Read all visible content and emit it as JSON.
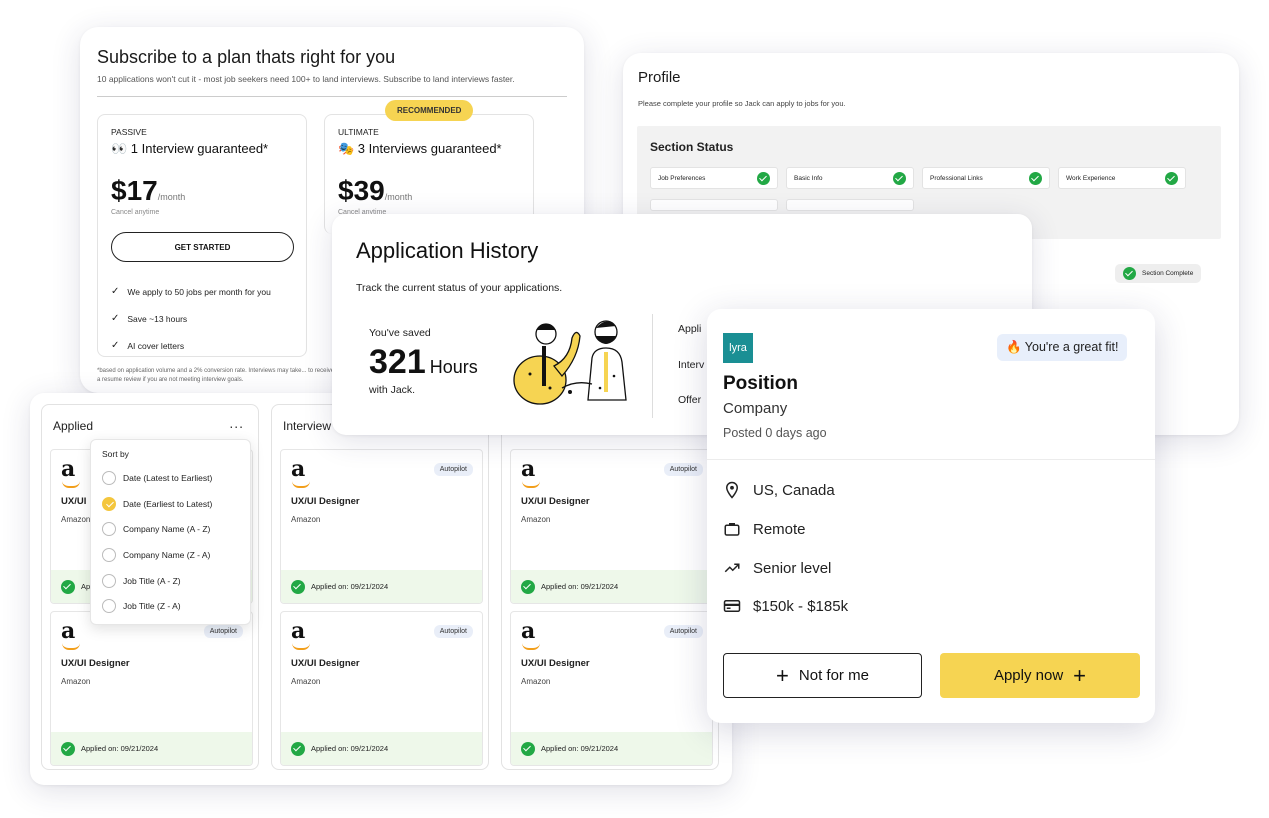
{
  "subscribe": {
    "title": "Subscribe to a plan thats right for you",
    "subtitle": "10 applications won't cut it - most job seekers need 100+ to land interviews. Subscribe to land interviews faster.",
    "recommended": "RECOMMENDED",
    "plans": [
      {
        "tier": "PASSIVE",
        "guarantee": "👀 1 Interview guaranteed*",
        "price": "$17",
        "period": "/month",
        "cancel": "Cancel anytime"
      },
      {
        "tier": "ULTIMATE",
        "guarantee": "🎭 3 Interviews guaranteed*",
        "price": "$39",
        "period": "/month",
        "cancel": "Cancel anytime"
      }
    ],
    "cta": "GET STARTED",
    "features": [
      "We apply to 50 jobs per month for you",
      "Save ~13 hours",
      "AI cover letters"
    ],
    "footnote": "*based on application volume and a 2% conversion rate. Interviews may take... to receive a resume review if you are not meeting interview goals."
  },
  "profile": {
    "title": "Profile",
    "subtitle": "Please complete your profile so Jack can apply to jobs for you.",
    "section_status": "Section Status",
    "chips": [
      "Job Preferences",
      "Basic Info",
      "Professional Links",
      "Work Experience"
    ],
    "section_complete": "Section Complete"
  },
  "kanban": {
    "columns": [
      {
        "title": "Applied",
        "menu": "..."
      },
      {
        "title": "Interview",
        "menu": ""
      },
      {
        "title": "",
        "menu": ""
      }
    ],
    "job": {
      "logo": "a",
      "badge": "Autopilot",
      "role": "UX/UI Designer",
      "company": "Amazon",
      "applied": "Applied on: 09/21/2024"
    },
    "applied_truncated": "Ap",
    "role_truncated": "UX/UI",
    "sort": {
      "header": "Sort by",
      "options": [
        "Date (Latest to Earliest)",
        "Date (Earliest to Latest)",
        "Company Name (A - Z)",
        "Company Name (Z - A)",
        "Job Title (A - Z)",
        "Job Title (Z - A)"
      ],
      "selected_index": 1
    }
  },
  "history": {
    "title": "Application History",
    "subtitle": "Track the current status of your applications.",
    "saved_label": "You've saved",
    "saved_value": "321",
    "saved_unit": "Hours",
    "saved_with": "with Jack.",
    "stats": [
      "Appli",
      "Interv",
      "Offer"
    ]
  },
  "jobcard": {
    "logo": "lyra",
    "fit_badge": "🔥 You're a great fit!",
    "position": "Position",
    "company": "Company",
    "posted": "Posted 0 days ago",
    "details": [
      {
        "icon": "location-pin-icon",
        "text": "US, Canada"
      },
      {
        "icon": "briefcase-icon",
        "text": "Remote"
      },
      {
        "icon": "trending-up-icon",
        "text": "Senior level"
      },
      {
        "icon": "credit-card-icon",
        "text": "$150k - $185k"
      }
    ],
    "not_for_me": "Not for me",
    "apply_now": "Apply now"
  },
  "colors": {
    "accent_yellow": "#f6d452",
    "success_green": "#22a845",
    "lyra_teal": "#1a8f94"
  }
}
